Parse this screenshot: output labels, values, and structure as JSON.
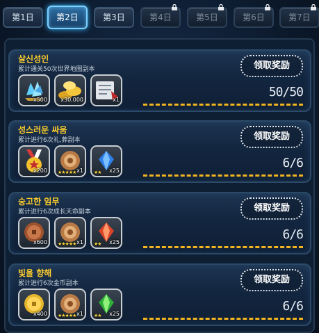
{
  "tabs": [
    {
      "label": "第1日",
      "state": "normal"
    },
    {
      "label": "第2日",
      "state": "active"
    },
    {
      "label": "第3日",
      "state": "normal"
    },
    {
      "label": "第4日",
      "state": "locked"
    },
    {
      "label": "第5日",
      "state": "locked"
    },
    {
      "label": "第6日",
      "state": "locked"
    },
    {
      "label": "第7日",
      "state": "locked"
    }
  ],
  "claim_label": "领取奖励",
  "quests": [
    {
      "title": "살신성인",
      "desc": "累计通关50次世界地图副本",
      "progress": "50/50",
      "items": [
        {
          "icon": "crystal-cluster-icon",
          "count": "x500",
          "stars": ""
        },
        {
          "icon": "gold-coins-icon",
          "count": "x30,000",
          "stars": ""
        },
        {
          "icon": "silver-scroll-icon",
          "count": "x1",
          "stars": ""
        }
      ]
    },
    {
      "title": "성스러운 싸움",
      "desc": "累计进行6次礼,葬副本",
      "progress": "6/6",
      "items": [
        {
          "icon": "medal-icon",
          "count": "x200",
          "stars": ""
        },
        {
          "icon": "bronze-orb-icon",
          "count": "x1",
          "stars": "★★★★★"
        },
        {
          "icon": "blue-gem-icon",
          "count": "x25",
          "stars": "★★"
        }
      ]
    },
    {
      "title": "숭고한 임무",
      "desc": "累计进行6次成长天命副本",
      "progress": "6/6",
      "items": [
        {
          "icon": "copper-coin-icon",
          "count": "x600",
          "stars": ""
        },
        {
          "icon": "bronze-orb-icon",
          "count": "x1",
          "stars": "★★★★★"
        },
        {
          "icon": "red-gem-icon",
          "count": "x25",
          "stars": "★★"
        }
      ]
    },
    {
      "title": "빛을 향해",
      "desc": "累计进行6次金币副本",
      "progress": "6/6",
      "items": [
        {
          "icon": "gold-coin-icon",
          "count": "x400",
          "stars": ""
        },
        {
          "icon": "bronze-orb-icon",
          "count": "x1",
          "stars": "★★★★★"
        },
        {
          "icon": "green-gem-icon",
          "count": "x25",
          "stars": "★★"
        }
      ]
    }
  ]
}
